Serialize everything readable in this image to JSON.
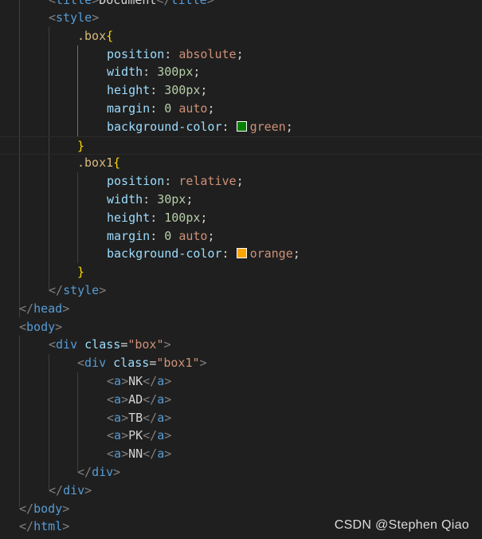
{
  "code": {
    "l0_title_open": "title",
    "l0_title_text": "Document",
    "l0_title_close": "title",
    "l1_style": "style",
    "l2_selector": ".box",
    "l3_prop": "position",
    "l3_val": "absolute",
    "l4_prop": "width",
    "l4_val": "300px",
    "l5_prop": "height",
    "l5_val": "300px",
    "l6_prop": "margin",
    "l6_val_num": "0",
    "l6_val_kw": "auto",
    "l7_prop": "background-color",
    "l7_val": "green",
    "l7_color": "#008000",
    "l9_selector": ".box1",
    "l10_prop": "position",
    "l10_val": "relative",
    "l11_prop": "width",
    "l11_val": "30px",
    "l12_prop": "height",
    "l12_val": "100px",
    "l13_prop": "margin",
    "l13_val_num": "0",
    "l13_val_kw": "auto",
    "l14_prop": "background-color",
    "l14_val": "orange",
    "l14_color": "#ffa500",
    "l16_style_close": "style",
    "l17_head_close": "head",
    "l18_body": "body",
    "l19_div": "div",
    "l19_attr": "class",
    "l19_str": "\"box\"",
    "l20_div": "div",
    "l20_attr": "class",
    "l20_str": "\"box1\"",
    "links": [
      "NK",
      "AD",
      "TB",
      "PK",
      "NN"
    ],
    "link_tag": "a",
    "l26_div_close": "div",
    "l27_div_close": "div",
    "l28_body_close": "body",
    "l29_html_close": "html"
  },
  "watermark": "CSDN @Stephen Qiao",
  "colors": {
    "background": "#1f1f1f",
    "tag": "#569cd6",
    "attribute": "#9cdcfe",
    "string": "#ce9178",
    "selector": "#d7ba7d",
    "brace": "#ffd700",
    "number": "#b5cea8"
  }
}
